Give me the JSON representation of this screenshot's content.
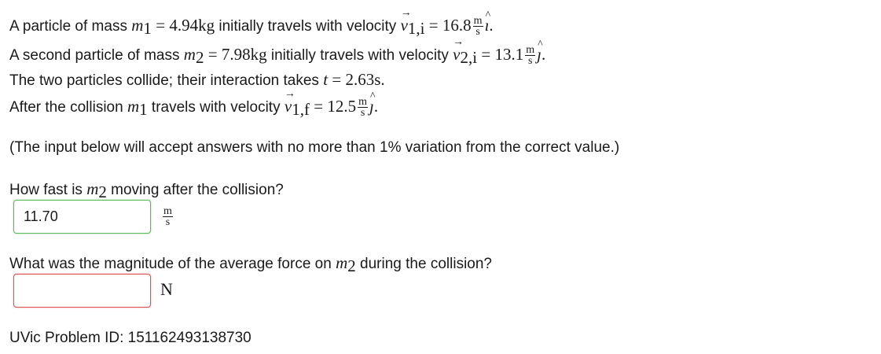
{
  "problem": {
    "line1": {
      "text_a": "A particle of mass",
      "mass_symbol": "m",
      "mass_sub": "1",
      "eq": "=",
      "mass_value": "4.94kg",
      "text_b": "initially travels with velocity",
      "vel_symbol": "v",
      "vel_sub": "1,i",
      "vel_value": "16.8",
      "unit_num": "m",
      "unit_den": "s",
      "dir": "ı",
      "end": "."
    },
    "line2": {
      "text_a": "A second particle of mass",
      "mass_symbol": "m",
      "mass_sub": "2",
      "eq": "=",
      "mass_value": "7.98kg",
      "text_b": "initially travels with velocity",
      "vel_symbol": "v",
      "vel_sub": "2,i",
      "vel_value": "13.1",
      "unit_num": "m",
      "unit_den": "s",
      "dir": "ȷ",
      "end": "."
    },
    "line3": {
      "text_a": "The two particles collide; their interaction takes",
      "time_symbol": "t",
      "eq": "=",
      "time_value": "2.63s."
    },
    "line4": {
      "text_a": "After the collision",
      "mass_symbol": "m",
      "mass_sub": "1",
      "text_b": "travels with velocity",
      "vel_symbol": "v",
      "vel_sub": "1,f",
      "vel_value": "12.5",
      "unit_num": "m",
      "unit_den": "s",
      "dir": "ȷ",
      "end": "."
    },
    "note": "(The input below will accept answers with no more than 1% variation from the correct value.)"
  },
  "question1": {
    "text_a": "How fast is",
    "mass_symbol": "m",
    "mass_sub": "2",
    "text_b": "moving after the collision?",
    "answer_value": "11.70",
    "unit_num": "m",
    "unit_den": "s",
    "status_color": "#5cb85c"
  },
  "question2": {
    "text_a": "What was the magnitude of the average force on",
    "mass_symbol": "m",
    "mass_sub": "2",
    "text_b": "during the collision?",
    "answer_value": "",
    "unit": "N",
    "status_color": "#d9534f"
  },
  "footer": {
    "problem_id": "UVic Problem ID: 151162493138730"
  }
}
